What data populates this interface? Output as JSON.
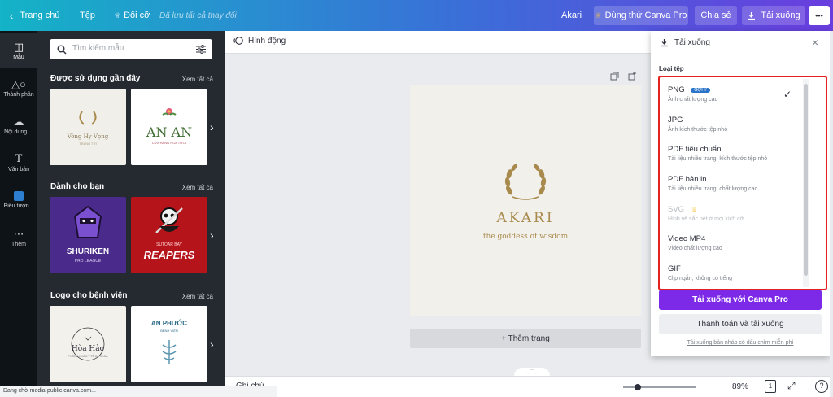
{
  "topbar": {
    "home": "Trang chủ",
    "file": "Tệp",
    "resize": "Đổi cỡ",
    "saved": "Đã lưu tất cả thay đổi",
    "doc_name": "Akari",
    "try_pro": "Dùng thử Canva Pro",
    "share": "Chia sẻ",
    "download": "Tải xuống",
    "more": "•••"
  },
  "rail": {
    "items": [
      {
        "label": "Mẫu",
        "icon": "template-icon"
      },
      {
        "label": "Thành phần",
        "icon": "elements-icon"
      },
      {
        "label": "Nội dung ...",
        "icon": "upload-icon"
      },
      {
        "label": "Văn bản",
        "icon": "text-icon"
      },
      {
        "label": "Biểu tượn...",
        "icon": "logo-icon"
      },
      {
        "label": "Thêm",
        "icon": "more-icon"
      }
    ]
  },
  "panel": {
    "search_placeholder": "Tìm kiếm mẫu",
    "sections": [
      {
        "title": "Được sử dụng gần đây",
        "more": "Xem tất cả",
        "thumbs": [
          {
            "line1": "Vòng Hy Vọng",
            "line2": "TRANG TRÍ"
          },
          {
            "line1": "AN AN",
            "line2": "CỬA HÀNG HOA TƯƠI"
          }
        ]
      },
      {
        "title": "Dành cho bạn",
        "more": "Xem tất cả",
        "thumbs": [
          {
            "line1": "SHURIKEN",
            "line2": "PRO LEAGUE"
          },
          {
            "line1": "REAPERS",
            "line2": "SUTOAR BAY"
          }
        ]
      },
      {
        "title": "Logo cho bệnh viện",
        "more": "Xem tất cả",
        "thumbs": [
          {
            "line1": "Hòa Hảo",
            "line2": "PHÒNG KHÁM Y TẾ ĐA KHOA"
          },
          {
            "line1": "AN PHƯỚC",
            "line2": "BỆNH VIỆN"
          }
        ]
      }
    ]
  },
  "canvas": {
    "animate": "Hình động",
    "title": "Akari",
    "subtitle": "the goddess of wisdom",
    "add_page": "+ Thêm trang",
    "notes": "Ghi chú",
    "zoom": "89%",
    "page_count": "1",
    "help": "?"
  },
  "download_panel": {
    "title": "Tải xuống",
    "file_type_label": "Loại tệp",
    "options": [
      {
        "name": "PNG",
        "badge": "GỢI Ý",
        "desc": "Ảnh chất lượng cao",
        "selected": true
      },
      {
        "name": "JPG",
        "desc": "Ảnh kích thước tệp nhỏ"
      },
      {
        "name": "PDF tiêu chuẩn",
        "desc": "Tài liệu nhiều trang, kích thước tệp nhỏ"
      },
      {
        "name": "PDF bản in",
        "desc": "Tài liệu nhiều trang, chất lượng cao"
      },
      {
        "name": "SVG",
        "desc": "Hình vẽ sắc nét ở mọi kích cỡ",
        "pro": true
      },
      {
        "name": "Video MP4",
        "desc": "Video chất lượng cao"
      },
      {
        "name": "GIF",
        "desc": "Clip ngắn, không có tiếng"
      }
    ],
    "pro_button": "Tải xuống với Canva Pro",
    "pay_button": "Thanh toán và tải xuống",
    "free_link": "Tải xuống bản nháp có dấu chìm miễn phí"
  },
  "status_bar": "Đang chờ media-public.canva.com...",
  "colors": {
    "accent": "#7d2ae8",
    "highlight": "#e52020",
    "gold": "#a88a4d"
  }
}
